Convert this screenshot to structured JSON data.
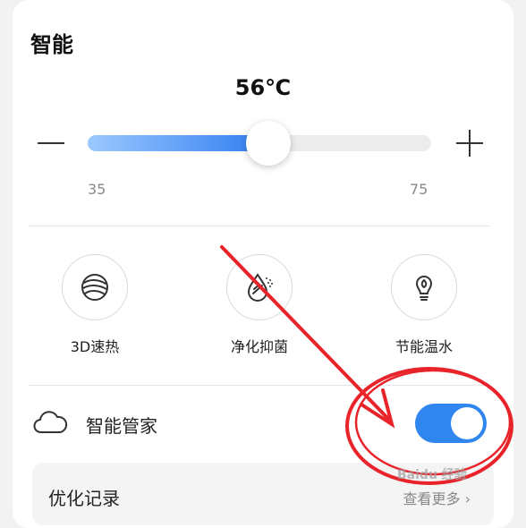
{
  "section": {
    "title": "智能"
  },
  "temperature": {
    "display": "56℃",
    "value": 56,
    "min": 35,
    "max": 75,
    "min_label": "35",
    "max_label": "75"
  },
  "features": [
    {
      "label": "3D速热",
      "icon": "3d-heat-icon"
    },
    {
      "label": "净化抑菌",
      "icon": "purify-drop-icon"
    },
    {
      "label": "节能温水",
      "icon": "energy-bulb-icon"
    }
  ],
  "manager": {
    "label": "智能管家",
    "icon": "cloud-icon",
    "toggle_on": true
  },
  "record": {
    "title": "优化记录",
    "more": "查看更多"
  },
  "watermark": {
    "text": "Baidu 经验"
  },
  "colors": {
    "accent": "#2f86ee",
    "slider_start": "#9cc8ff",
    "slider_end": "#2f7df0",
    "annotation": "#e8232a"
  }
}
